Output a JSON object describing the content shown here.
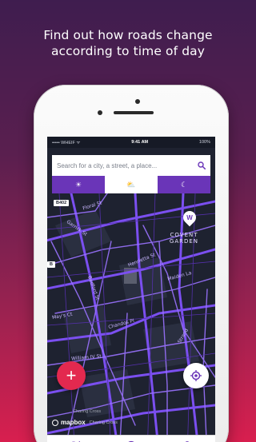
{
  "headline": {
    "line1": "Find out how roads change",
    "line2": "according to time of day"
  },
  "statusbar": {
    "carrier": "••••• WHEIF ᯤ",
    "time": "9:41 AM",
    "battery": "100%"
  },
  "search": {
    "placeholder": "Search for a city, a street, a place...",
    "icon": "search-icon"
  },
  "time_toggle": {
    "options": [
      {
        "name": "morning",
        "icon": "sun-icon",
        "glyph": "☀",
        "active": false
      },
      {
        "name": "day",
        "icon": "sun-cloud-icon",
        "glyph": "⛅",
        "active": true
      },
      {
        "name": "night",
        "icon": "moon-icon",
        "glyph": "☾",
        "active": false
      }
    ]
  },
  "map": {
    "road_badge": "B402",
    "side_badge": "B",
    "district": {
      "line1": "COVENT",
      "line2": "GARDEN"
    },
    "street_labels": [
      "Floral St",
      "Garrick St",
      "Henrietta St",
      "Maiden La",
      "Bedford St",
      "May's Ct",
      "Chandos Pl",
      "William IV St",
      "Strand"
    ],
    "place_label": "Charing Cross",
    "place_label_small": "Charing Cross"
  },
  "mapbox": {
    "logo": "mapbox",
    "attribution": "Charing Cross"
  },
  "colors": {
    "accent": "#6a35b8",
    "road": "#7b4ff0",
    "fab": "#e3294f"
  },
  "tabbar": {
    "tabs": [
      {
        "name": "map",
        "icon": "map-icon"
      },
      {
        "name": "history",
        "icon": "clock-icon"
      },
      {
        "name": "profile",
        "icon": "user-icon"
      }
    ]
  }
}
